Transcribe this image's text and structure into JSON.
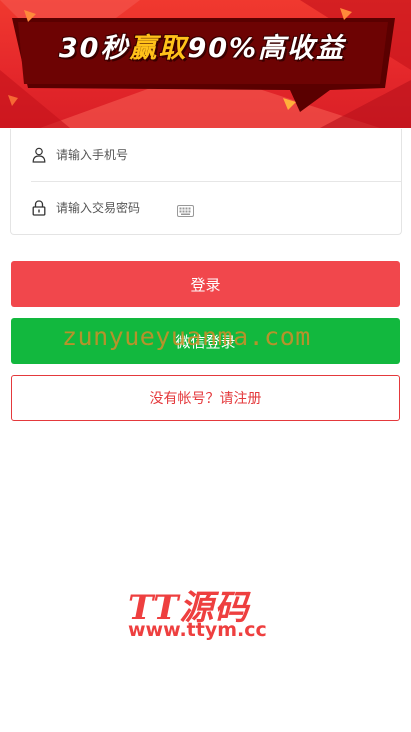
{
  "banner": {
    "title_prefix": "30秒",
    "title_highlight": "赢取",
    "title_suffix": "90%高收益"
  },
  "form": {
    "phone_placeholder": "请输入手机号",
    "password_placeholder": "请输入交易密码"
  },
  "buttons": {
    "login_label": "登录",
    "wechat_label": "微信登录",
    "register_label": "没有帐号？请注册"
  },
  "watermark": {
    "overlay_text": "zunyueyuanma.com",
    "logo_text": "TT源码",
    "logo_url": "www.ttym.cc"
  },
  "colors": {
    "banner_red": "#e5282b",
    "login_red": "#f1474c",
    "wechat_green": "#12b83e",
    "register_red": "#e4393c"
  },
  "icons": {
    "phone_field": "user-icon",
    "password_field": "lock-icon",
    "keyboard": "keyboard-icon"
  }
}
